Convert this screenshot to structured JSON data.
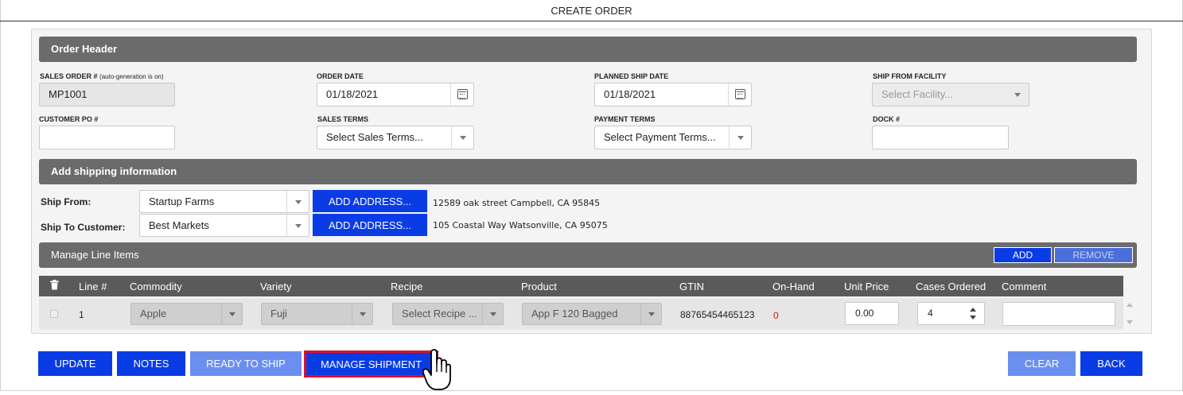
{
  "page_title": "CREATE ORDER",
  "order_header": {
    "title": "Order Header",
    "sales_order_label": "SALES ORDER #",
    "sales_order_note": "(auto-generation is on)",
    "sales_order_value": "MP1001",
    "order_date_label": "ORDER DATE",
    "order_date_value": "01/18/2021",
    "planned_ship_date_label": "PLANNED SHIP DATE",
    "planned_ship_date_value": "01/18/2021",
    "ship_from_facility_label": "SHIP FROM FACILITY",
    "ship_from_facility_placeholder": "Select Facility...",
    "customer_po_label": "CUSTOMER PO #",
    "customer_po_value": "",
    "sales_terms_label": "SALES TERMS",
    "sales_terms_value": "Select Sales Terms...",
    "payment_terms_label": "PAYMENT TERMS",
    "payment_terms_value": "Select Payment Terms...",
    "dock_label": "DOCK #",
    "dock_value": ""
  },
  "shipping": {
    "title": "Add shipping information",
    "ship_from_label": "Ship From:",
    "ship_from_value": "Startup Farms",
    "ship_from_address": "12589 oak street Campbell, CA 95845",
    "ship_to_label": "Ship To Customer:",
    "ship_to_value": "Best Markets",
    "ship_to_address": "105 Coastal Way Watsonville, CA 95075",
    "add_address_label": "ADD ADDRESS..."
  },
  "line_items": {
    "title": "Manage Line Items",
    "add_label": "ADD",
    "remove_label": "REMOVE",
    "columns": [
      "Line #",
      "Commodity",
      "Variety",
      "Recipe",
      "Product",
      "GTIN",
      "On-Hand",
      "Unit Price",
      "Cases Ordered",
      "Comment"
    ],
    "rows": [
      {
        "line": "1",
        "commodity": "Apple",
        "variety": "Fuji",
        "recipe": "Select Recipe ...",
        "product": "App F 120 Bagged",
        "gtin": "88765454465123",
        "on_hand": "0",
        "unit_price": "0.00",
        "cases_ordered": "4",
        "comment": ""
      }
    ]
  },
  "footer": {
    "update": "UPDATE",
    "notes": "NOTES",
    "ready_to_ship": "READY TO SHIP",
    "manage_shipment": "MANAGE SHIPMENT",
    "clear": "CLEAR",
    "back": "BACK"
  },
  "colors": {
    "primary_button": "#0a3ce6",
    "disabled_button": "#6b8ff0",
    "section_bar": "#6b6b6b",
    "highlight_border": "#e0102a",
    "on_hand_zero": "#e01010"
  },
  "icons": {
    "trash": "trash-icon",
    "calendar": "calendar-icon",
    "cursor": "hand-pointer-icon"
  }
}
